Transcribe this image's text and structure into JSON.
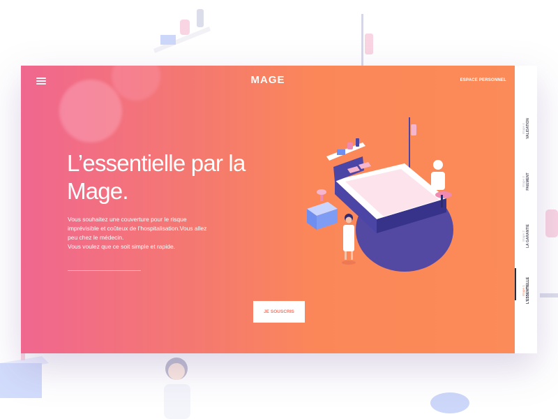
{
  "header": {
    "logo": "MAGE",
    "account_link": "ESPACE PERSONNEL"
  },
  "hero": {
    "headline": "L’essentielle par la Mage.",
    "description": [
      "Vous souhaitez une couverture pour le risque",
      "imprévisible et coûteux de l’hospitalisation.Vous allez",
      "peu chez le médecin.",
      "Vous voulez que ce soit simple et rapide."
    ],
    "cta_label": "JE SOUSCRIS"
  },
  "steps": [
    {
      "number": "Etape 4",
      "title": "VALIDATION"
    },
    {
      "number": "Etape 3",
      "title": "PAIEMENT"
    },
    {
      "number": "Etape 2",
      "title": "LA GARANTIE"
    },
    {
      "number": "Etape 1",
      "title": "L’ESSENTIELLE"
    }
  ],
  "colors": {
    "gradient_start": "#f0678f",
    "gradient_end": "#fb8b58",
    "accent_purple": "#4b46a6",
    "cta_text": "#f47766"
  },
  "icons": [
    "menu-icon",
    "hospital-illustration"
  ]
}
